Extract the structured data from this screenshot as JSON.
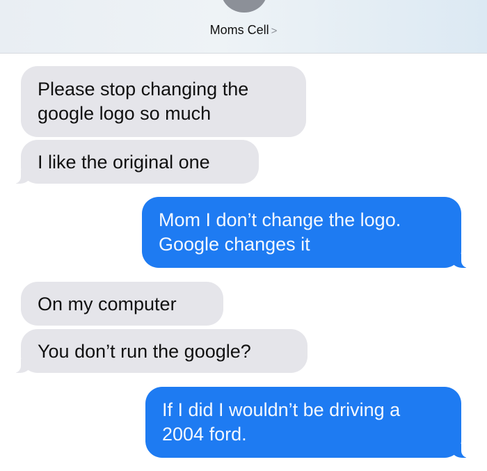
{
  "header": {
    "contact_name": "Moms Cell",
    "chevron": ">"
  },
  "messages": [
    {
      "direction": "incoming",
      "lines": [
        "Please stop changing the",
        "google logo so much"
      ]
    },
    {
      "direction": "incoming",
      "lines": [
        "I like the original one"
      ]
    },
    {
      "direction": "outgoing",
      "lines": [
        "Mom I don’t change the logo.",
        "Google changes it"
      ]
    },
    {
      "direction": "incoming",
      "lines": [
        "On my computer"
      ]
    },
    {
      "direction": "incoming",
      "lines": [
        "You don’t run the google?"
      ]
    },
    {
      "direction": "outgoing",
      "lines": [
        "If I did I wouldn’t be driving a",
        "2004 ford."
      ]
    }
  ],
  "colors": {
    "incoming_bubble": "#e5e5ea",
    "outgoing_bubble": "#1e7bf2",
    "header_background": "#eef3f6"
  }
}
